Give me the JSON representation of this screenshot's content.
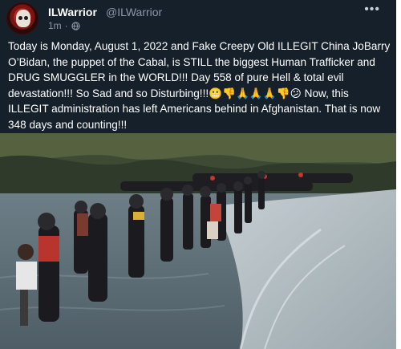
{
  "post": {
    "display_name": "ILWarrior",
    "handle": "@ILWarrior",
    "time": "1m",
    "more_label": "•••",
    "text": "Today is Monday, August 1, 2022 and Fake Creepy Old ILLEGIT China JoBarry O’Bidan, the puppet of the Cabal, is STILL the biggest Human Trafficker and DRUG SMUGGLER in the WORLD!!! Day 558 of pure Hell & total evil devastation!!! So Sad and so Disturbing!!!😬👎🙏🙏🙏👎😕 Now, this ILLEGIT administration has left Americans behind in Afghanistan. That is now 348 days and counting!!!"
  },
  "colors": {
    "card_bg": "#15202b",
    "secondary_text": "#8b98a5",
    "primary_text": "#ffffff"
  }
}
